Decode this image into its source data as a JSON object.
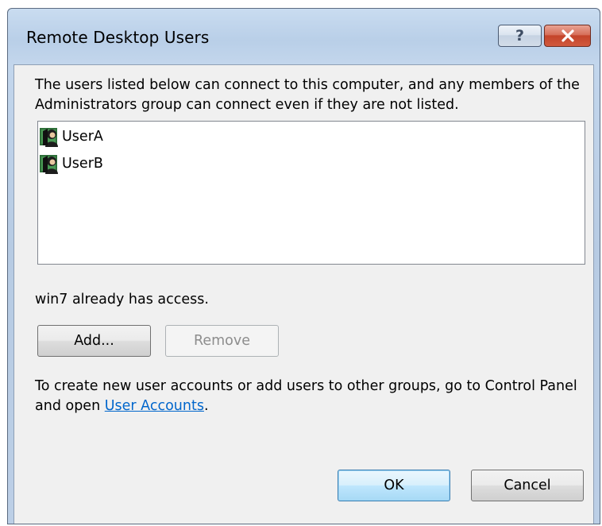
{
  "window": {
    "title": "Remote Desktop Users",
    "help_label": "?",
    "close_icon": "close-icon"
  },
  "description": "The users listed below can connect to this computer, and any members of the Administrators group can connect even if they are not listed.",
  "users": [
    {
      "name": "UserA",
      "icon": "user-icon"
    },
    {
      "name": "UserB",
      "icon": "user-icon"
    }
  ],
  "status": "win7 already has access.",
  "buttons": {
    "add": "Add...",
    "remove": "Remove",
    "ok": "OK",
    "cancel": "Cancel"
  },
  "footer": {
    "text_before": "To create new user accounts or add users to other groups, go to Control Panel and open ",
    "link": "User Accounts",
    "text_after": "."
  },
  "colors": {
    "link": "#0066cc",
    "close_button": "#c4442a",
    "default_button_border": "#3c7fb1"
  }
}
